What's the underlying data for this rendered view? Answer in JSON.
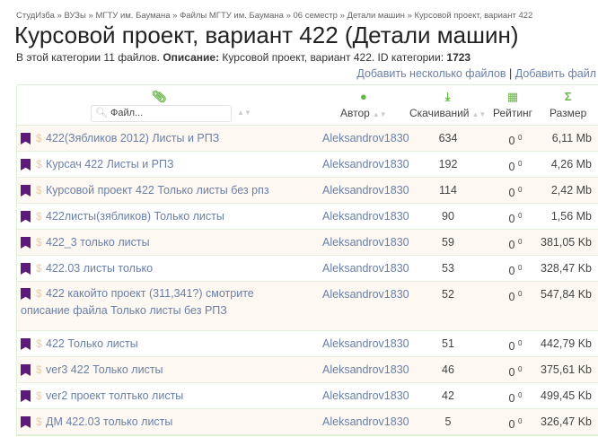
{
  "breadcrumb": [
    "СтудИзба",
    "ВУЗы",
    "МГТУ им. Баумана",
    "Файлы МГТУ им. Баумана",
    "06 семестр",
    "Детали машин",
    "Курсовой проект, вариант 422"
  ],
  "breadcrumb_sep": " » ",
  "title": "Курсовой проект, вариант 422 (Детали машин)",
  "info": {
    "prefix": "В этой категории 11 файлов. ",
    "desc_label": "Описание:",
    "desc": " Курсовой проект, вариант 422. ID категории: ",
    "id": "1723"
  },
  "links": {
    "add_many": "Добавить несколько файлов",
    "sep": "|",
    "add_one": "Добавить файл"
  },
  "table": {
    "search_placeholder": "Файл...",
    "headers": {
      "author": "Автор",
      "downloads": "Скачиваний",
      "rating": "Рейтинг",
      "size": "Размер"
    },
    "rows": [
      {
        "name": "422(Зябликов 2012) Листы и РПЗ",
        "author": "Aleksandrov1830",
        "downloads": "634",
        "rating": "0",
        "votes": "0",
        "size": "6,11 Mb"
      },
      {
        "name": "Курсач 422 Листы и РПЗ",
        "author": "Aleksandrov1830",
        "downloads": "192",
        "rating": "0",
        "votes": "0",
        "size": "4,26 Mb"
      },
      {
        "name": "Курсовой проект 422 Только листы без рпз",
        "author": "Aleksandrov1830",
        "downloads": "114",
        "rating": "0",
        "votes": "0",
        "size": "2,42 Mb"
      },
      {
        "name": "422листы(зябликов) Только листы",
        "author": "Aleksandrov1830",
        "downloads": "90",
        "rating": "0",
        "votes": "0",
        "size": "1,56 Mb"
      },
      {
        "name": "422_3 только листы",
        "author": "Aleksandrov1830",
        "downloads": "59",
        "rating": "0",
        "votes": "0",
        "size": "381,05 Kb"
      },
      {
        "name": "422.03 листы только",
        "author": "Aleksandrov1830",
        "downloads": "53",
        "rating": "0",
        "votes": "0",
        "size": "328,47 Kb"
      },
      {
        "name": "422 какойто проект (311,341?) смотрите описание файла Только листы без РПЗ",
        "author": "Aleksandrov1830",
        "downloads": "52",
        "rating": "0",
        "votes": "0",
        "size": "547,84 Kb"
      },
      {
        "name": "422 Только листы",
        "author": "Aleksandrov1830",
        "downloads": "51",
        "rating": "0",
        "votes": "0",
        "size": "442,79 Kb"
      },
      {
        "name": "ver3 422 Только листы",
        "author": "Aleksandrov1830",
        "downloads": "46",
        "rating": "0",
        "votes": "0",
        "size": "375,61 Kb"
      },
      {
        "name": "ver2 проект толтько листы",
        "author": "Aleksandrov1830",
        "downloads": "42",
        "rating": "0",
        "votes": "0",
        "size": "499,45 Kb"
      },
      {
        "name": "ДМ 422.03 только листы",
        "author": "Aleksandrov1830",
        "downloads": "5",
        "rating": "0",
        "votes": "0",
        "size": "326,47 Kb"
      }
    ]
  },
  "colors": {
    "accent": "#6ab34a",
    "link": "#6a7fa8",
    "bookmark": "#5e1a7a"
  }
}
